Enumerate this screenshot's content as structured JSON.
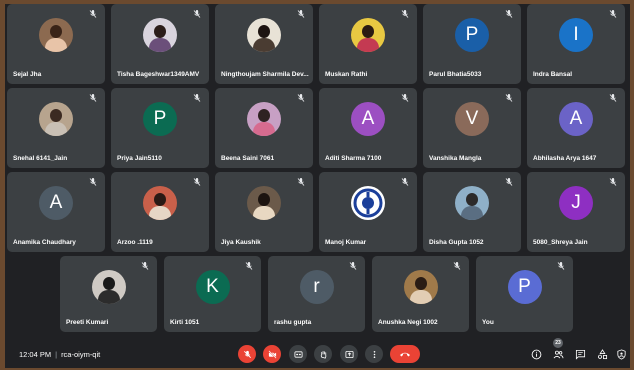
{
  "colors": {
    "page_frame": "#6b4a2f",
    "stage": "#202124",
    "tile": "#3c4043",
    "danger": "#ea4335",
    "text": "#ffffff"
  },
  "tiles": [
    [
      {
        "name": "Sejal Jha",
        "avatar": "photo",
        "colors": [
          "#8c6a50",
          "#3a2418",
          "#e8c4a8"
        ]
      },
      {
        "name": "Tisha Bageshwar1349AMV",
        "avatar": "photo",
        "colors": [
          "#d9d4de",
          "#2b1d1a",
          "#6b4f7a"
        ]
      },
      {
        "name": "Ningthoujam Sharmila Dev...",
        "avatar": "photo",
        "colors": [
          "#e8e2d6",
          "#1d1411",
          "#4a3c32"
        ]
      },
      {
        "name": "Muskan Rathi",
        "avatar": "photo",
        "colors": [
          "#e8c842",
          "#2a1a12",
          "#c43a52"
        ]
      },
      {
        "name": "Parul Bhatia5033",
        "avatar": "letter",
        "letter": "P",
        "color": "#1a5fa8"
      },
      {
        "name": "Indra Bansal",
        "avatar": "letter",
        "letter": "I",
        "color": "#1a73c8"
      }
    ],
    [
      {
        "name": "Snehal 6141_Jain",
        "avatar": "photo",
        "colors": [
          "#b7a48e",
          "#3b2a22",
          "#c9c0b5"
        ]
      },
      {
        "name": "Priya Jain5110",
        "avatar": "letter",
        "letter": "P",
        "color": "#0b6b52"
      },
      {
        "name": "Beena Saini 7061",
        "avatar": "photo",
        "colors": [
          "#c7a0c4",
          "#2e2222",
          "#d66b8f"
        ]
      },
      {
        "name": "Aditi Sharma 7100",
        "avatar": "letter",
        "letter": "A",
        "color": "#9c4fc2"
      },
      {
        "name": "Vanshika Mangla",
        "avatar": "letter",
        "letter": "V",
        "color": "#8a6a5a"
      },
      {
        "name": "Abhilasha Arya 1647",
        "avatar": "letter",
        "letter": "A",
        "color": "#6b63c7"
      }
    ],
    [
      {
        "name": "Anamika Chaudhary",
        "avatar": "letter",
        "letter": "A",
        "color": "#4e5b66"
      },
      {
        "name": "Arzoo .1119",
        "avatar": "photo",
        "colors": [
          "#c9604a",
          "#2a1a15",
          "#e6d6c5"
        ]
      },
      {
        "name": "Jiya Kaushik",
        "avatar": "photo",
        "colors": [
          "#6b5a4a",
          "#1c1410",
          "#e8d8c2"
        ]
      },
      {
        "name": "Manoj Kumar",
        "avatar": "logo"
      },
      {
        "name": "Disha Gupta 1052",
        "avatar": "photo",
        "colors": [
          "#8fb0c8",
          "#2c2a2a",
          "#5a6e82"
        ]
      },
      {
        "name": "5080_Shreya Jain",
        "avatar": "letter",
        "letter": "J",
        "color": "#8e2fc2"
      }
    ],
    [
      {
        "name": "Preeti Kumari",
        "avatar": "photo",
        "colors": [
          "#cfcac4",
          "#1a1a1a",
          "#2c2c2c"
        ]
      },
      {
        "name": "Kirti 1051",
        "avatar": "letter",
        "letter": "K",
        "color": "#0b6b52"
      },
      {
        "name": "rashu gupta",
        "avatar": "letter",
        "letter": "r",
        "color": "#4e5b66"
      },
      {
        "name": "Anushka Negi 1002",
        "avatar": "photo",
        "colors": [
          "#a07a4a",
          "#2a1c14",
          "#e2cdb4"
        ]
      },
      {
        "name": "You",
        "avatar": "letter",
        "letter": "P",
        "color": "#5a6cd4"
      }
    ]
  ],
  "controlbar": {
    "time": "12:04 PM",
    "meeting_code": "rca-oiym-qit",
    "participant_count": "23",
    "buttons": [
      "mic-off",
      "camera-off",
      "captions",
      "raise-hand",
      "present",
      "more-options",
      "leave-call"
    ],
    "right_buttons": [
      "info",
      "people",
      "chat",
      "activities",
      "host-controls"
    ]
  }
}
